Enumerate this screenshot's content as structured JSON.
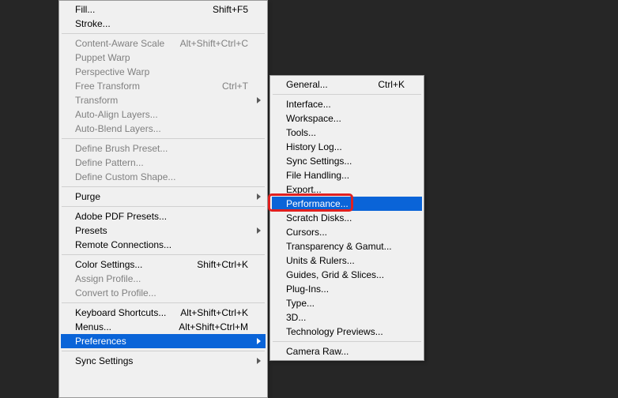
{
  "main_menu": {
    "groups": [
      [
        {
          "label": "Fill...",
          "shortcut": "Shift+F5",
          "enabled": true,
          "submenu": false
        },
        {
          "label": "Stroke...",
          "shortcut": "",
          "enabled": true,
          "submenu": false
        }
      ],
      [
        {
          "label": "Content-Aware Scale",
          "shortcut": "Alt+Shift+Ctrl+C",
          "enabled": false,
          "submenu": false
        },
        {
          "label": "Puppet Warp",
          "shortcut": "",
          "enabled": false,
          "submenu": false
        },
        {
          "label": "Perspective Warp",
          "shortcut": "",
          "enabled": false,
          "submenu": false
        },
        {
          "label": "Free Transform",
          "shortcut": "Ctrl+T",
          "enabled": false,
          "submenu": false
        },
        {
          "label": "Transform",
          "shortcut": "",
          "enabled": false,
          "submenu": true
        },
        {
          "label": "Auto-Align Layers...",
          "shortcut": "",
          "enabled": false,
          "submenu": false
        },
        {
          "label": "Auto-Blend Layers...",
          "shortcut": "",
          "enabled": false,
          "submenu": false
        }
      ],
      [
        {
          "label": "Define Brush Preset...",
          "shortcut": "",
          "enabled": false,
          "submenu": false
        },
        {
          "label": "Define Pattern...",
          "shortcut": "",
          "enabled": false,
          "submenu": false
        },
        {
          "label": "Define Custom Shape...",
          "shortcut": "",
          "enabled": false,
          "submenu": false
        }
      ],
      [
        {
          "label": "Purge",
          "shortcut": "",
          "enabled": true,
          "submenu": true
        }
      ],
      [
        {
          "label": "Adobe PDF Presets...",
          "shortcut": "",
          "enabled": true,
          "submenu": false
        },
        {
          "label": "Presets",
          "shortcut": "",
          "enabled": true,
          "submenu": true
        },
        {
          "label": "Remote Connections...",
          "shortcut": "",
          "enabled": true,
          "submenu": false
        }
      ],
      [
        {
          "label": "Color Settings...",
          "shortcut": "Shift+Ctrl+K",
          "enabled": true,
          "submenu": false
        },
        {
          "label": "Assign Profile...",
          "shortcut": "",
          "enabled": false,
          "submenu": false
        },
        {
          "label": "Convert to Profile...",
          "shortcut": "",
          "enabled": false,
          "submenu": false
        }
      ],
      [
        {
          "label": "Keyboard Shortcuts...",
          "shortcut": "Alt+Shift+Ctrl+K",
          "enabled": true,
          "submenu": false
        },
        {
          "label": "Menus...",
          "shortcut": "Alt+Shift+Ctrl+M",
          "enabled": true,
          "submenu": false
        },
        {
          "label": "Preferences",
          "shortcut": "",
          "enabled": true,
          "submenu": true,
          "highlight": true
        }
      ],
      [
        {
          "label": "Sync Settings",
          "shortcut": "",
          "enabled": true,
          "submenu": true
        }
      ]
    ]
  },
  "sub_menu": {
    "groups": [
      [
        {
          "label": "General...",
          "shortcut": "Ctrl+K",
          "enabled": true
        }
      ],
      [
        {
          "label": "Interface...",
          "shortcut": "",
          "enabled": true
        },
        {
          "label": "Workspace...",
          "shortcut": "",
          "enabled": true
        },
        {
          "label": "Tools...",
          "shortcut": "",
          "enabled": true
        },
        {
          "label": "History Log...",
          "shortcut": "",
          "enabled": true
        },
        {
          "label": "Sync Settings...",
          "shortcut": "",
          "enabled": true
        },
        {
          "label": "File Handling...",
          "shortcut": "",
          "enabled": true
        },
        {
          "label": "Export...",
          "shortcut": "",
          "enabled": true
        },
        {
          "label": "Performance...",
          "shortcut": "",
          "enabled": true,
          "highlight": true,
          "redbox": true
        },
        {
          "label": "Scratch Disks...",
          "shortcut": "",
          "enabled": true
        },
        {
          "label": "Cursors...",
          "shortcut": "",
          "enabled": true
        },
        {
          "label": "Transparency & Gamut...",
          "shortcut": "",
          "enabled": true
        },
        {
          "label": "Units & Rulers...",
          "shortcut": "",
          "enabled": true
        },
        {
          "label": "Guides, Grid & Slices...",
          "shortcut": "",
          "enabled": true
        },
        {
          "label": "Plug-Ins...",
          "shortcut": "",
          "enabled": true
        },
        {
          "label": "Type...",
          "shortcut": "",
          "enabled": true
        },
        {
          "label": "3D...",
          "shortcut": "",
          "enabled": true
        },
        {
          "label": "Technology Previews...",
          "shortcut": "",
          "enabled": true
        }
      ],
      [
        {
          "label": "Camera Raw...",
          "shortcut": "",
          "enabled": true
        }
      ]
    ]
  }
}
